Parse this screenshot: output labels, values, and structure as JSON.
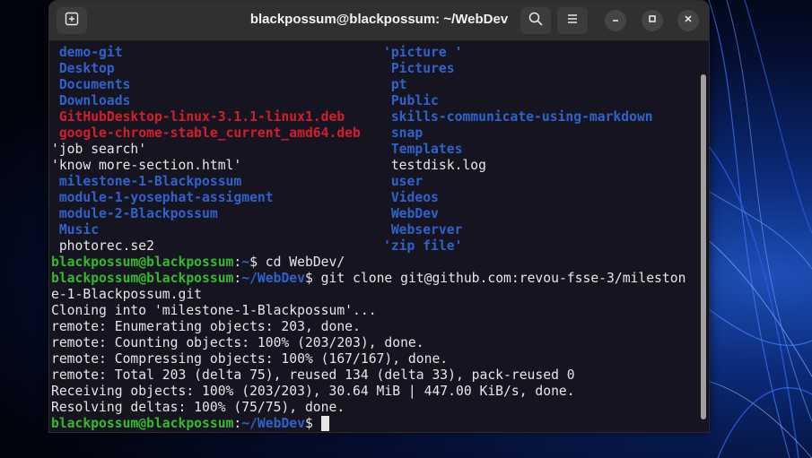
{
  "window": {
    "title": "blackpossum@blackpossum: ~/WebDev"
  },
  "icons": {
    "new_tab": "new-tab-icon",
    "search": "search-icon",
    "menu": "hamburger-menu-icon",
    "minimize": "minimize-icon",
    "maximize": "maximize-icon",
    "close": "close-icon"
  },
  "colors": {
    "terminal_bg": "#171421",
    "directory": "#2f63c9",
    "deb_package": "#d0202c",
    "prompt_user": "#33bb2a",
    "text": "#e6e6e6"
  },
  "listing": {
    "left": [
      {
        "text": " demo-git",
        "kind": "dir"
      },
      {
        "text": " Desktop",
        "kind": "dir"
      },
      {
        "text": " Documents",
        "kind": "dir"
      },
      {
        "text": " Downloads",
        "kind": "dir"
      },
      {
        "text": " GitHubDesktop-linux-3.1.1-linux1.deb",
        "kind": "deb"
      },
      {
        "text": " google-chrome-stable_current_amd64.deb",
        "kind": "deb"
      },
      {
        "text": "'job search'",
        "kind": "plain"
      },
      {
        "text": "'know more-section.html'",
        "kind": "plain"
      },
      {
        "text": " milestone-1-Blackpossum",
        "kind": "dir"
      },
      {
        "text": " module-1-yosephat-assigment",
        "kind": "dir"
      },
      {
        "text": " module-2-Blackpossum",
        "kind": "dir"
      },
      {
        "text": " Music",
        "kind": "dir"
      },
      {
        "text": " photorec.se2",
        "kind": "plain"
      }
    ],
    "right": [
      {
        "text": "'picture '",
        "kind": "dir"
      },
      {
        "text": " Pictures",
        "kind": "dir"
      },
      {
        "text": " pt",
        "kind": "dir"
      },
      {
        "text": " Public",
        "kind": "dir"
      },
      {
        "text": " skills-communicate-using-markdown",
        "kind": "dir"
      },
      {
        "text": " snap",
        "kind": "dir"
      },
      {
        "text": " Templates",
        "kind": "dir"
      },
      {
        "text": " testdisk.log",
        "kind": "plain"
      },
      {
        "text": " user",
        "kind": "dir"
      },
      {
        "text": " Videos",
        "kind": "dir"
      },
      {
        "text": " WebDev",
        "kind": "dir"
      },
      {
        "text": " Webserver",
        "kind": "dir"
      },
      {
        "text": "'zip file'",
        "kind": "dir"
      }
    ]
  },
  "prompts": [
    {
      "user": "blackpossum@blackpossum",
      "colon": ":",
      "path": "~",
      "symbol": "$ ",
      "command": "cd WebDev/"
    },
    {
      "user": "blackpossum@blackpossum",
      "colon": ":",
      "path": "~/WebDev",
      "symbol": "$ ",
      "command": "git clone git@github.com:revou-fsse-3/mileston"
    },
    {
      "user": "blackpossum@blackpossum",
      "colon": ":",
      "path": "~/WebDev",
      "symbol": "$ ",
      "command": ""
    }
  ],
  "output": [
    "e-1-Blackpossum.git",
    "Cloning into 'milestone-1-Blackpossum'...",
    "remote: Enumerating objects: 203, done.",
    "remote: Counting objects: 100% (203/203), done.",
    "remote: Compressing objects: 100% (167/167), done.",
    "remote: Total 203 (delta 75), reused 134 (delta 33), pack-reused 0",
    "Receiving objects: 100% (203/203), 30.64 MiB | 447.00 KiB/s, done.",
    "Resolving deltas: 100% (75/75), done."
  ]
}
